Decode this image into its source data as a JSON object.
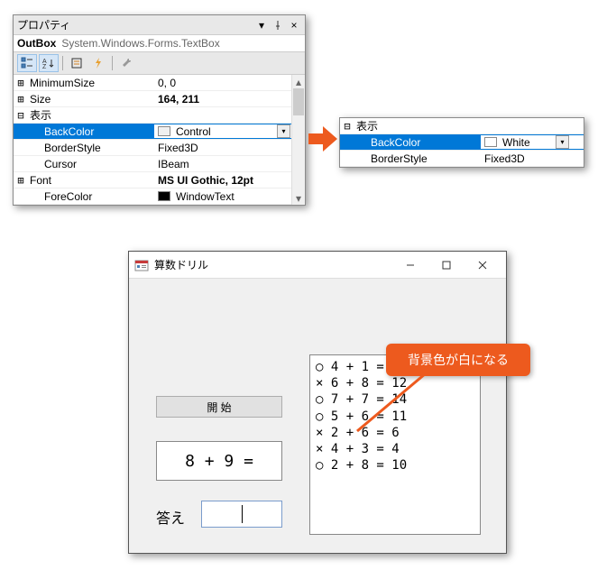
{
  "prop_panel": {
    "title": "プロパティ",
    "pin_icon": "📌",
    "close_icon": "×",
    "object_name": "OutBox",
    "object_type": "System.Windows.Forms.TextBox",
    "toolbar": {
      "categorized": "▦",
      "alpha": "A↓",
      "pages": "▤",
      "events": "⚡",
      "wrench": "🔧"
    },
    "rows": [
      {
        "exp": "⊞",
        "key": "MinimumSize",
        "val": "0, 0",
        "indent": 0
      },
      {
        "exp": "⊞",
        "key": "Size",
        "val": "164, 211",
        "indent": 0,
        "bold": true
      },
      {
        "exp": "⊟",
        "key": "表示",
        "val": "",
        "indent": 0,
        "category": true
      },
      {
        "exp": "",
        "key": "BackColor",
        "val": "Control",
        "indent": 1,
        "selected": true,
        "swatch": "#f0f0f0",
        "dd": true
      },
      {
        "exp": "",
        "key": "BorderStyle",
        "val": "Fixed3D",
        "indent": 1
      },
      {
        "exp": "",
        "key": "Cursor",
        "val": "IBeam",
        "indent": 1
      },
      {
        "exp": "⊞",
        "key": "Font",
        "val": "MS UI Gothic, 12pt",
        "indent": 0,
        "bold": true
      },
      {
        "exp": "",
        "key": "ForeColor",
        "val": "WindowText",
        "indent": 1,
        "swatch": "#000000"
      }
    ]
  },
  "prop_snip": {
    "rows": [
      {
        "exp": "⊟",
        "key": "表示",
        "val": "",
        "indent": 0,
        "category": true
      },
      {
        "exp": "",
        "key": "BackColor",
        "val": "White",
        "indent": 1,
        "selected": true,
        "swatch": "#ffffff",
        "dd": true
      },
      {
        "exp": "",
        "key": "BorderStyle",
        "val": "Fixed3D",
        "indent": 1
      }
    ]
  },
  "app": {
    "title": "算数ドリル",
    "start_label": "開 始",
    "expr": "8 + 9 =",
    "answer_label": "答え",
    "output": [
      {
        "mark": "○",
        "text": "4 + 1 = 5"
      },
      {
        "mark": "×",
        "text": "6 + 8 = 12"
      },
      {
        "mark": "○",
        "text": "7 + 7 = 14"
      },
      {
        "mark": "○",
        "text": "5 + 6 = 11"
      },
      {
        "mark": "×",
        "text": "2 + 6 = 6"
      },
      {
        "mark": "×",
        "text": "4 + 3 = 4"
      },
      {
        "mark": "○",
        "text": "2 + 8 = 10"
      }
    ]
  },
  "callout": "背景色が白になる"
}
